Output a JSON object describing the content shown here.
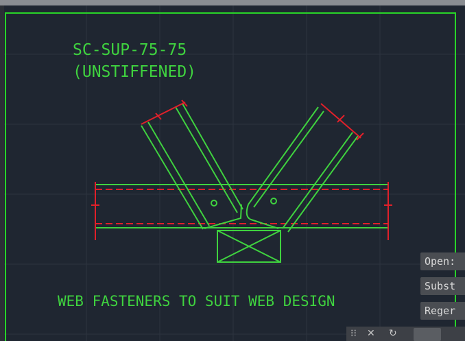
{
  "drawing": {
    "title_line1": "SC-SUP-75-75",
    "title_line2": "(UNSTIFFENED)",
    "note": "WEB FASTENERS TO SUIT WEB DESIGN"
  },
  "colors": {
    "background": "#1f2631",
    "linework": "#3fd23f",
    "dimension": "#e0202a",
    "grid": "#2c3440",
    "border": "#28d428"
  },
  "command_suggestions": [
    {
      "label": "Open:"
    },
    {
      "label": "Subst"
    },
    {
      "label": "Reger"
    }
  ],
  "command_bar": {
    "grip_icon": "grip-icon",
    "close_icon": "close-icon",
    "recent_icon": "recent-commands-icon",
    "prompt_icon": "command-prompt-icon"
  }
}
